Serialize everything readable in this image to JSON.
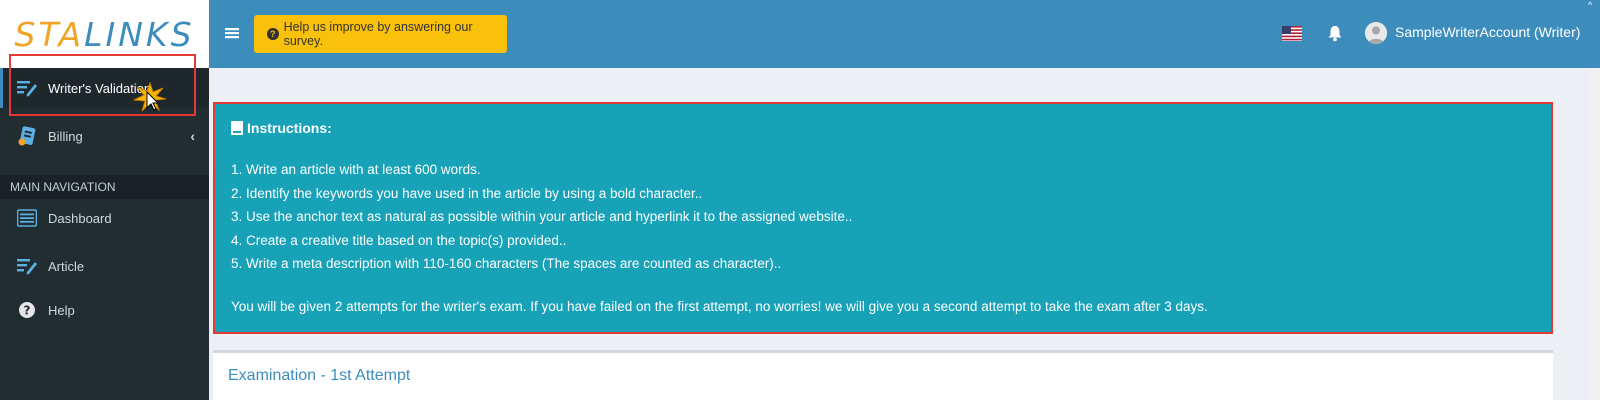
{
  "brand": {
    "logo_text_a": "STA",
    "logo_text_b": "LINKS"
  },
  "sidebar": {
    "items": [
      {
        "label": "Writer's Validation",
        "icon": "edit-list-icon"
      },
      {
        "label": "Billing",
        "icon": "billing-icon"
      }
    ],
    "nav_header": "MAIN NAVIGATION",
    "nav_items": [
      {
        "label": "Dashboard",
        "icon": "list-icon"
      },
      {
        "label": "Article",
        "icon": "edit-list-icon"
      },
      {
        "label": "Help",
        "icon": "question-icon"
      }
    ]
  },
  "topbar": {
    "survey_label": "Help us improve by answering our survey.",
    "user_label": "SampleWriterAccount (Writer)"
  },
  "instructions": {
    "title": "Instructions:",
    "steps": [
      "1. Write an article with at least 600 words.",
      "2. Identify the keywords you have used in the article by using a bold character..",
      "3. Use the anchor text as natural as possible within your article and hyperlink it to the assigned website..",
      "4. Create a creative title based on the topic(s) provided..",
      "5. Write a meta description with 110-160 characters (The spaces are counted as character).."
    ],
    "note": "You will be given 2 attempts for the writer's exam. If you have failed on the first attempt, no worries! we will give you a second attempt to take the exam after 3 days."
  },
  "exam": {
    "title": "Examination - 1st Attempt"
  },
  "colors": {
    "topbar": "#3c8dbc",
    "sidebar": "#222d32",
    "callout": "#17a2b8",
    "survey": "#f9c10b",
    "highlight": "#e53935"
  }
}
